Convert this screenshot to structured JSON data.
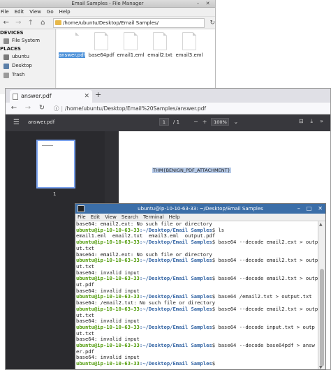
{
  "file_manager": {
    "title": "Email Samples - File Manager",
    "menu": [
      "File",
      "Edit",
      "View",
      "Go",
      "Help"
    ],
    "path": "/home/ubuntu/Desktop/Email Samples/",
    "devices_header": "DEVICES",
    "devices": [
      "File System"
    ],
    "places_header": "PLACES",
    "places": [
      "ubuntu",
      "Desktop",
      "Trash"
    ],
    "files": [
      {
        "name": "answer.pdf",
        "selected": true
      },
      {
        "name": "base64pdf",
        "selected": false
      },
      {
        "name": "email1.eml",
        "selected": false
      },
      {
        "name": "email2.txt",
        "selected": false
      },
      {
        "name": "email3.eml",
        "selected": false
      }
    ]
  },
  "browser": {
    "tab_title": "answer.pdf",
    "url": "/home/ubuntu/Desktop/Email%20Samples/answer.pdf",
    "pdf": {
      "filename": "answer.pdf",
      "page_current": "1",
      "page_total_label": "/ 1",
      "zoom": "100%",
      "thumbnail_page": "1",
      "content_text": "THM{BENIGN_PDF_ATTACHMENT}"
    }
  },
  "terminal": {
    "title": "ubuntu@ip-10-10-63-33: ~/Desktop/Email Samples",
    "menu": [
      "File",
      "Edit",
      "View",
      "Search",
      "Terminal",
      "Help"
    ],
    "lines": [
      {
        "type": "out",
        "text": "base64: email2.ext: No such file or directory"
      },
      {
        "type": "cmd",
        "user": "ubuntu@ip-10-10-63-33",
        "path": ":~/Desktop/Email Samples",
        "cmd": "$ ls"
      },
      {
        "type": "out",
        "text": "email1.eml  email2.txt  email3.eml  output.pdf"
      },
      {
        "type": "cmd",
        "user": "ubuntu@ip-10-10-63-33",
        "path": ":~/Desktop/Email Samples",
        "cmd": "$ base64 --decode email2.ext > outp"
      },
      {
        "type": "out",
        "text": "ut.txt"
      },
      {
        "type": "out",
        "text": "base64: email2.ext: No such file or directory"
      },
      {
        "type": "cmd",
        "user": "ubuntu@ip-10-10-63-33",
        "path": ":~/Desktop/Email Samples",
        "cmd": "$ base64 --decode email2.txt > outp"
      },
      {
        "type": "out",
        "text": "ut.txt"
      },
      {
        "type": "out",
        "text": "base64: invalid input"
      },
      {
        "type": "cmd",
        "user": "ubuntu@ip-10-10-63-33",
        "path": ":~/Desktop/Email Samples",
        "cmd": "$ base64 --decode email2.txt > outp"
      },
      {
        "type": "out",
        "text": "ut.pdf"
      },
      {
        "type": "out",
        "text": "base64: invalid input"
      },
      {
        "type": "cmd",
        "user": "ubuntu@ip-10-10-63-33",
        "path": ":~/Desktop/Email Samples",
        "cmd": "$ base64 /email2.txt > output.txt"
      },
      {
        "type": "out",
        "text": "base64: /email2.txt: No such file or directory"
      },
      {
        "type": "cmd",
        "user": "ubuntu@ip-10-10-63-33",
        "path": ":~/Desktop/Email Samples",
        "cmd": "$ base64 --decode email2.txt > outp"
      },
      {
        "type": "out",
        "text": "ut.txt"
      },
      {
        "type": "out",
        "text": "base64: invalid input"
      },
      {
        "type": "cmd",
        "user": "ubuntu@ip-10-10-63-33",
        "path": ":~/Desktop/Email Samples",
        "cmd": "$ base64 --decode input.txt > outp"
      },
      {
        "type": "out",
        "text": "ut.txt"
      },
      {
        "type": "out",
        "text": "base64: invalid input"
      },
      {
        "type": "cmd",
        "user": "ubuntu@ip-10-10-63-33",
        "path": ":~/Desktop/Email Samples",
        "cmd": "$ base64 --decode base64pdf > answ"
      },
      {
        "type": "out",
        "text": "er.pdf"
      },
      {
        "type": "out",
        "text": "base64: invalid input"
      },
      {
        "type": "cmd",
        "user": "ubuntu@ip-10-10-63-33",
        "path": ":~/Desktop/Email Samples",
        "cmd": "$ "
      }
    ]
  }
}
